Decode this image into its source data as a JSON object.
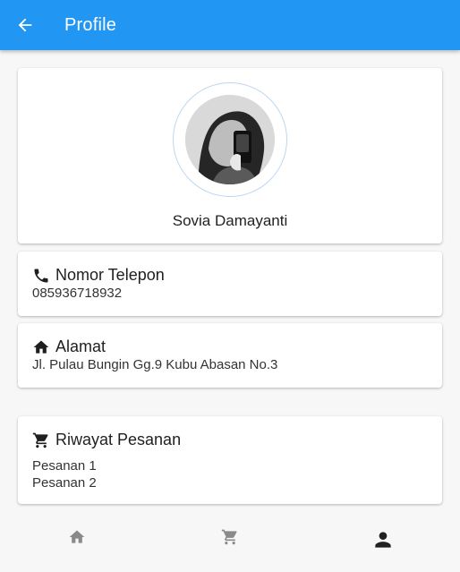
{
  "appbar": {
    "title": "Profile",
    "back_icon": "arrow-back-icon"
  },
  "profile": {
    "name": "Sovia Damayanti",
    "avatar_icon": "avatar-photo"
  },
  "phone": {
    "icon": "phone-icon",
    "label": "Nomor Telepon",
    "value": "085936718932"
  },
  "address": {
    "icon": "home-icon",
    "label": "Alamat",
    "value": "Jl. Pulau Bungin Gg.9 Kubu Abasan No.3"
  },
  "orders": {
    "icon": "cart-icon",
    "label": "Riwayat Pesanan",
    "items": [
      "Pesanan 1",
      "Pesanan 2"
    ]
  },
  "bottom_nav": {
    "items": [
      {
        "icon": "home-icon",
        "active": false
      },
      {
        "icon": "cart-icon",
        "active": false
      },
      {
        "icon": "person-icon",
        "active": true
      }
    ]
  },
  "colors": {
    "primary": "#2196f3",
    "nav_inactive": "#8a8a8a",
    "nav_active": "#212121"
  }
}
